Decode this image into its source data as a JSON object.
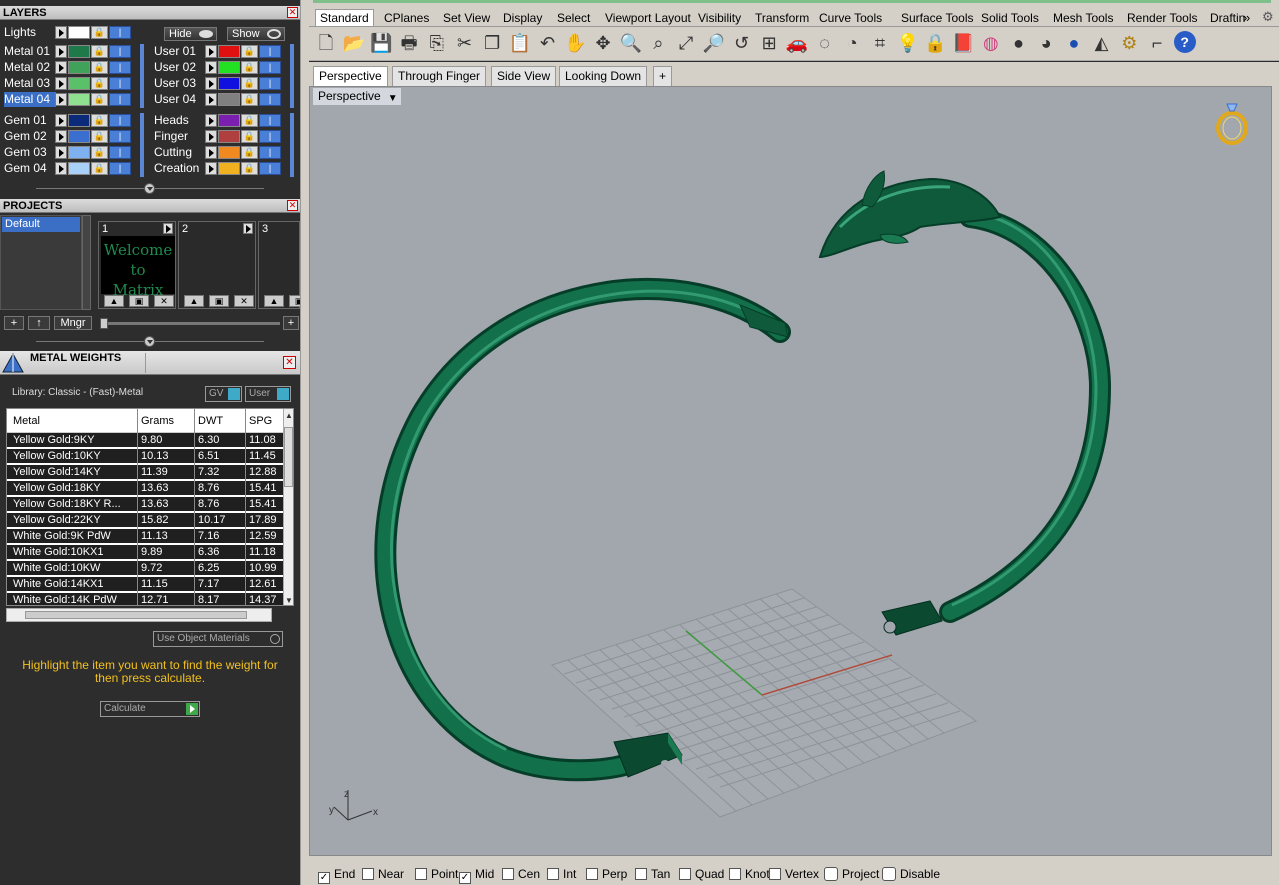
{
  "layers": {
    "title": "LAYERS",
    "lights_label": "Lights",
    "hide_label": "Hide",
    "show_label": "Show",
    "left": [
      {
        "name": "Metal 01",
        "color": "#1f7a4a"
      },
      {
        "name": "Metal 02",
        "color": "#3fa15a"
      },
      {
        "name": "Metal 03",
        "color": "#5ac06a"
      },
      {
        "name": "Metal 04",
        "color": "#8fe08f",
        "selected": true
      },
      {
        "name": "Gem 01",
        "color": "#0b2a7a"
      },
      {
        "name": "Gem 02",
        "color": "#3a6fd0"
      },
      {
        "name": "Gem 03",
        "color": "#7fb0f0"
      },
      {
        "name": "Gem 04",
        "color": "#a8d0f8"
      }
    ],
    "right": [
      {
        "name": "User 01",
        "color": "#e01010"
      },
      {
        "name": "User 02",
        "color": "#22e022"
      },
      {
        "name": "User 03",
        "color": "#1010e0"
      },
      {
        "name": "User 04",
        "color": "#808080"
      },
      {
        "name": "Heads",
        "color": "#7a1fb0"
      },
      {
        "name": "Finger",
        "color": "#b04040"
      },
      {
        "name": "Cutting",
        "color": "#f08a20"
      },
      {
        "name": "Creation",
        "color": "#f0b020"
      }
    ]
  },
  "projects": {
    "title": "PROJECTS",
    "list": [
      "Default"
    ],
    "cards": [
      {
        "num": "1",
        "thumb": "Welcome to Matrix"
      },
      {
        "num": "2",
        "thumb": ""
      },
      {
        "num": "3",
        "thumb": ""
      }
    ],
    "add_label": "+",
    "up_label": "↑",
    "mngr_label": "Mngr",
    "plus_right": "+"
  },
  "metal_weights": {
    "title": "METAL WEIGHTS",
    "library": "Library: Classic - (Fast)-Metal",
    "gv_label": "GV",
    "user_label": "User",
    "columns": [
      "Metal",
      "Grams",
      "DWT",
      "SPG"
    ],
    "rows": [
      [
        "Yellow Gold:9KY",
        "9.80",
        "6.30",
        "11.08"
      ],
      [
        "Yellow Gold:10KY",
        "10.13",
        "6.51",
        "11.45"
      ],
      [
        "Yellow Gold:14KY",
        "11.39",
        "7.32",
        "12.88"
      ],
      [
        "Yellow Gold:18KY",
        "13.63",
        "8.76",
        "15.41"
      ],
      [
        "Yellow Gold:18KY R...",
        "13.63",
        "8.76",
        "15.41"
      ],
      [
        "Yellow Gold:22KY",
        "15.82",
        "10.17",
        "17.89"
      ],
      [
        "White Gold:9K PdW",
        "11.13",
        "7.16",
        "12.59"
      ],
      [
        "White Gold:10KX1",
        "9.89",
        "6.36",
        "11.18"
      ],
      [
        "White Gold:10KW",
        "9.72",
        "6.25",
        "10.99"
      ],
      [
        "White Gold:14KX1",
        "11.15",
        "7.17",
        "12.61"
      ],
      [
        "White Gold:14K PdW",
        "12.71",
        "8.17",
        "14.37"
      ]
    ],
    "use_object_materials": "Use Object Materials",
    "hint": "Highlight the item you want to find the weight for then press calculate.",
    "calculate": "Calculate"
  },
  "toolbar_tabs": [
    "Standard",
    "CPlanes",
    "Set View",
    "Display",
    "Select",
    "Viewport Layout",
    "Visibility",
    "Transform",
    "Curve Tools",
    "Surface Tools",
    "Solid Tools",
    "Mesh Tools",
    "Render Tools",
    "Draftin"
  ],
  "toolbar_icons": [
    "new-file-icon",
    "open-icon",
    "save-icon",
    "print-icon",
    "import-icon",
    "cut-icon",
    "copy-icon",
    "paste-icon",
    "undo-icon",
    "pan-icon",
    "rotate-icon",
    "zoom-icon",
    "zoom-window-icon",
    "zoom-extents-icon",
    "zoom-selected-icon",
    "undo-view-icon",
    "four-view-icon",
    "car-icon",
    "ghosted-icon",
    "snap-icon",
    "grid-icon",
    "bulb-icon",
    "lock-icon",
    "book-icon",
    "color-wheel-icon",
    "sphere-gray-icon",
    "sphere-shaded-icon",
    "sphere-blue-icon",
    "render-icon",
    "options-icon",
    "dimension-icon",
    "help-icon"
  ],
  "view_tabs": [
    "Perspective",
    "Through Finger",
    "Side View",
    "Looking Down"
  ],
  "viewport": {
    "label": "Perspective",
    "axis_z": "z",
    "axis_x": "x",
    "axis_y": "y"
  },
  "osnaps": [
    {
      "label": "End",
      "checked": true
    },
    {
      "label": "Near",
      "checked": false
    },
    {
      "label": "Point",
      "checked": false
    },
    {
      "label": "Mid",
      "checked": true
    },
    {
      "label": "Cen",
      "checked": false
    },
    {
      "label": "Int",
      "checked": false
    },
    {
      "label": "Perp",
      "checked": false
    },
    {
      "label": "Tan",
      "checked": false
    },
    {
      "label": "Quad",
      "checked": false
    },
    {
      "label": "Knot",
      "checked": false
    },
    {
      "label": "Vertex",
      "checked": false
    }
  ],
  "status_extra": [
    {
      "label": "Project",
      "checked": false
    },
    {
      "label": "Disable",
      "checked": false
    }
  ],
  "colors": {
    "accent": "#3b6fc6",
    "model": "#0f5a3c",
    "viewport_bg": "#a2a7ad",
    "hint": "#f2c01e"
  }
}
